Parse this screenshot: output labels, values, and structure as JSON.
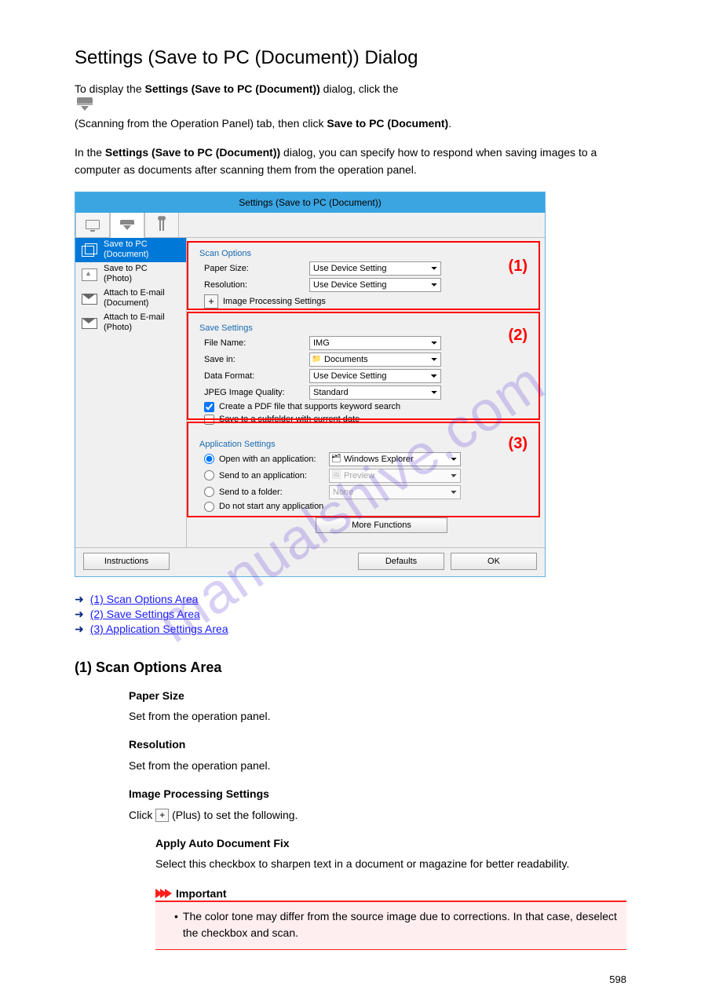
{
  "title": "Settings (Save to PC (Document)) Dialog",
  "intro_paragraph_prefix": "To display the ",
  "intro_bold": "Settings (Save to PC (Document))",
  "intro_paragraph_suffix": " dialog, click the ",
  "intro_after_icon": " (Scanning from the Operation Panel) tab, then click ",
  "intro_click_bold": "Save to PC (Document)",
  "intro_tail": ".",
  "intro_line2_prefix": "In the ",
  "intro_line2_bold": "Settings (Save to PC (Document))",
  "intro_line2_suffix": " dialog, you can specify how to respond when saving images to a computer as documents after scanning them from the operation panel.",
  "dialog": {
    "titlebar": "Settings (Save to PC (Document))",
    "sidebar_items": [
      {
        "line1": "Save to PC",
        "line2": "(Document)"
      },
      {
        "line1": "Save to PC",
        "line2": "(Photo)"
      },
      {
        "line1": "Attach to E-mail",
        "line2": "(Document)"
      },
      {
        "line1": "Attach to E-mail",
        "line2": "(Photo)"
      }
    ],
    "scan_options": {
      "legend": "Scan Options",
      "paper_size_label": "Paper Size:",
      "paper_size_value": "Use Device Setting",
      "resolution_label": "Resolution:",
      "resolution_value": "Use Device Setting",
      "img_proc_label": "Image Processing Settings"
    },
    "save_settings": {
      "legend": "Save Settings",
      "file_name_label": "File Name:",
      "file_name_value": "IMG",
      "save_in_label": "Save in:",
      "save_in_value": "Documents",
      "data_format_label": "Data Format:",
      "data_format_value": "Use Device Setting",
      "jpeg_label": "JPEG Image Quality:",
      "jpeg_value": "Standard",
      "check_pdf": "Create a PDF file that supports keyword search",
      "check_subfolder": "Save to a subfolder with current date"
    },
    "app_settings": {
      "legend": "Application Settings",
      "open_with_label": "Open with an application:",
      "open_with_value": "Windows Explorer",
      "send_app_label": "Send to an application:",
      "send_app_value": "Preview",
      "send_folder_label": "Send to a folder:",
      "send_folder_value": "None",
      "dont_start_label": "Do not start any application",
      "more_functions": "More Functions"
    },
    "buttons": {
      "instructions": "Instructions",
      "defaults": "Defaults",
      "ok": "OK"
    },
    "callouts": {
      "c1": "(1)",
      "c2": "(2)",
      "c3": "(3)"
    }
  },
  "links": {
    "a1": "(1) Scan Options Area",
    "a2": "(2) Save Settings Area",
    "a3": "(3) Application Settings Area"
  },
  "section1_heading": "(1) Scan Options Area",
  "paper_size_item": "Paper Size",
  "paper_size_desc": "Set from the operation panel.",
  "resolution_item": "Resolution",
  "resolution_desc": "Set from the operation panel.",
  "img_proc_item": "Image Processing Settings",
  "img_proc_desc_prefix": "Click ",
  "img_proc_desc_suffix": " (Plus) to set the following.",
  "moire_item": "Apply Auto Document Fix",
  "moire_desc": "Select this checkbox to sharpen text in a document or magazine for better readability.",
  "important_label": "Important",
  "important_body": "The color tone may differ from the source image due to corrections. In that case, deselect the checkbox and scan.",
  "page_number": "598",
  "watermark": "manualshive.com"
}
